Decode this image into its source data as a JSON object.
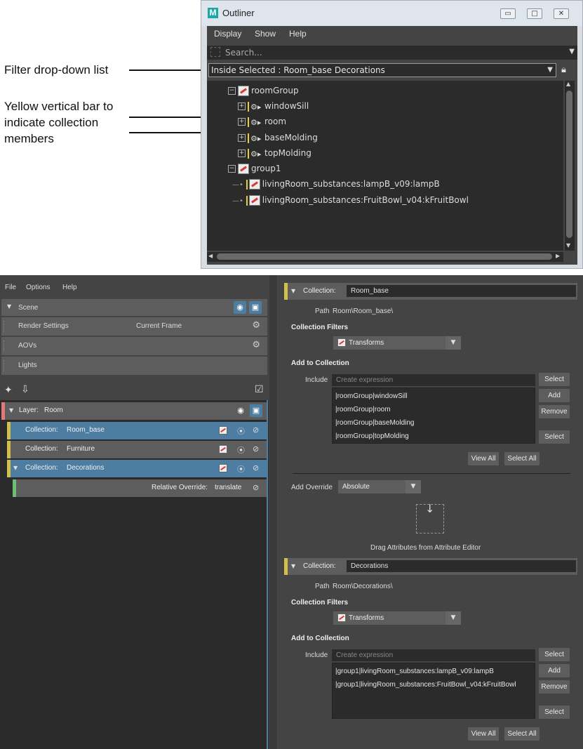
{
  "annotations": {
    "filter": "Filter drop-down list",
    "yellow_bar": [
      "Yellow vertical bar to",
      "indicate collection",
      "members"
    ]
  },
  "outliner": {
    "logo": "M",
    "title": "Outliner",
    "menu": [
      "Display",
      "Show",
      "Help"
    ],
    "search_placeholder": "Search...",
    "filter_value": "Inside Selected : Room_base Decorations",
    "tree": [
      {
        "label": "roomGroup",
        "kind": "group"
      },
      {
        "label": "windowSill",
        "kind": "mesh"
      },
      {
        "label": "room",
        "kind": "mesh"
      },
      {
        "label": "baseMolding",
        "kind": "mesh"
      },
      {
        "label": "topMolding",
        "kind": "mesh"
      },
      {
        "label": "group1",
        "kind": "group"
      },
      {
        "label": "livingRoom_substances:lampB_v09:lampB",
        "kind": "group"
      },
      {
        "label": "livingRoom_substances:FruitBowl_v04:kFruitBowl",
        "kind": "group"
      }
    ]
  },
  "render_setup": {
    "menu": [
      "File",
      "Options",
      "Help"
    ],
    "scene": {
      "label": "Scene",
      "items": [
        {
          "label": "Render Settings",
          "value": "Current Frame"
        },
        {
          "label": "AOVs",
          "value": ""
        },
        {
          "label": "Lights",
          "value": ""
        }
      ]
    },
    "layer": {
      "prefix": "Layer:",
      "name": "Room"
    },
    "collections": [
      {
        "prefix": "Collection:",
        "name": "Room_base"
      },
      {
        "prefix": "Collection:",
        "name": "Furniture"
      },
      {
        "prefix": "Collection:",
        "name": "Decorations"
      }
    ],
    "override": {
      "label": "Relative Override:",
      "attr": "translate"
    },
    "accent_colors": {
      "layer": "#e07b7b",
      "collection": "#d3c04a",
      "override": "#6fbf73",
      "selected": "#4d7da0"
    }
  },
  "properties": {
    "sections": [
      {
        "title": "Collection:",
        "name": "Room_base",
        "path_label": "Path",
        "path": "Room\\Room_base\\",
        "filters_label": "Collection Filters",
        "filter": "Transforms",
        "add_label": "Add to Collection",
        "include_label": "Include",
        "expr_placeholder": "Create expression",
        "members": [
          "|roomGroup|windowSill",
          "|roomGroup|room",
          "|roomGroup|baseMolding",
          "|roomGroup|topMolding"
        ],
        "buttons": {
          "select": "Select",
          "add": "Add",
          "remove": "Remove",
          "select2": "Select",
          "view_all": "View All",
          "select_all": "Select All"
        }
      },
      {
        "title": "Collection:",
        "name": "Decorations",
        "path_label": "Path",
        "path": "Room\\Decorations\\",
        "filters_label": "Collection Filters",
        "filter": "Transforms",
        "add_label": "Add to Collection",
        "include_label": "Include",
        "expr_placeholder": "Create expression",
        "members": [
          "|group1|livingRoom_substances:lampB_v09:lampB",
          "|group1|livingRoom_substances:FruitBowl_v04:kFruitBowl"
        ],
        "buttons": {
          "select": "Select",
          "add": "Add",
          "remove": "Remove",
          "select2": "Select",
          "view_all": "View All",
          "select_all": "Select All"
        }
      }
    ],
    "add_override_label": "Add Override",
    "add_override_value": "Absolute",
    "drag_hint": "Drag Attributes from Attribute Editor"
  }
}
